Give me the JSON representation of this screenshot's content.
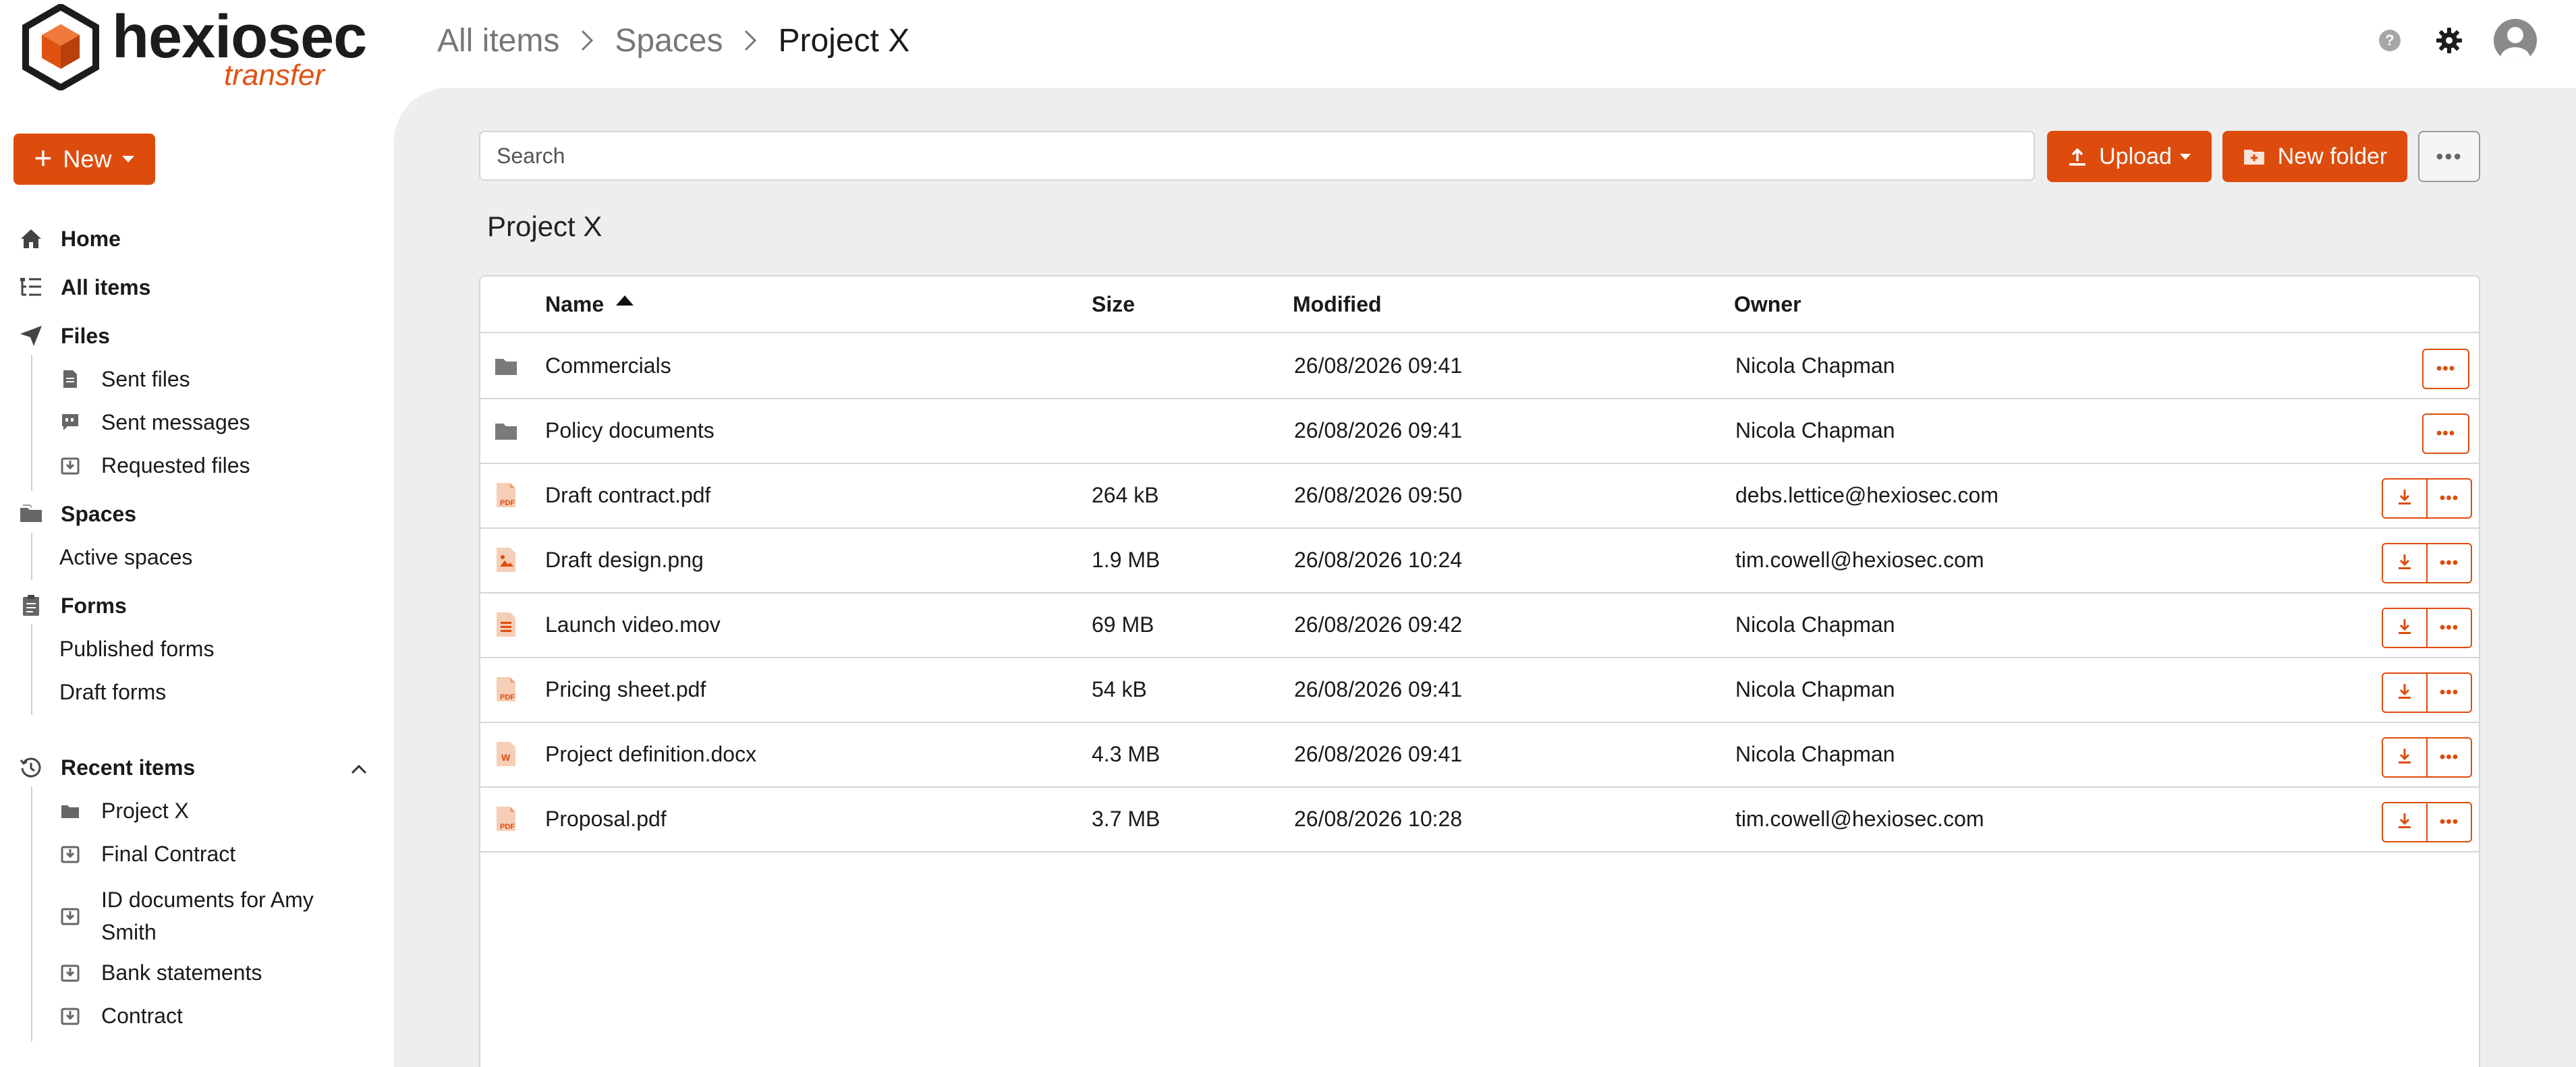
{
  "brand": {
    "name": "hexiosec",
    "product": "transfer",
    "accent": "#dd4c0d"
  },
  "breadcrumb": [
    "All items",
    "Spaces",
    "Project X"
  ],
  "topbar": {
    "help_label": "?",
    "help_icon": "help-icon",
    "settings_icon": "gear-icon",
    "avatar_icon": "user-avatar-icon"
  },
  "sidebar": {
    "new_label": "New",
    "home": "Home",
    "all_items": "All items",
    "files": {
      "label": "Files",
      "items": [
        "Sent files",
        "Sent messages",
        "Requested files"
      ]
    },
    "spaces": {
      "label": "Spaces",
      "items": [
        "Active spaces"
      ]
    },
    "forms": {
      "label": "Forms",
      "items": [
        "Published forms",
        "Draft forms"
      ]
    },
    "recent": {
      "label": "Recent items",
      "items": [
        "Project X",
        "Final Contract",
        "ID documents for Amy Smith",
        "Bank statements",
        "Contract"
      ]
    }
  },
  "toolbar": {
    "search_placeholder": "Search",
    "upload_label": "Upload",
    "new_folder_label": "New folder",
    "more_label": "•••"
  },
  "folder_title": "Project X",
  "table": {
    "columns": [
      "Name",
      "Size",
      "Modified",
      "Owner"
    ],
    "sort": {
      "column": "Name",
      "direction": "ascending"
    },
    "more_label": "•••",
    "rows": [
      {
        "name": "Commercials",
        "size": "",
        "modified": "26/08/2026 09:41",
        "owner": "Nicola Chapman",
        "kind": "folder",
        "icon": "folder-icon"
      },
      {
        "name": "Policy documents",
        "size": "",
        "modified": "26/08/2026 09:41",
        "owner": "Nicola Chapman",
        "kind": "folder",
        "icon": "folder-icon"
      },
      {
        "name": "Draft contract.pdf",
        "size": "264 kB",
        "modified": "26/08/2026 09:50",
        "owner": "debs.lettice@hexiosec.com",
        "kind": "pdf",
        "icon": "pdf-file-icon"
      },
      {
        "name": "Draft design.png",
        "size": "1.9 MB",
        "modified": "26/08/2026 10:24",
        "owner": "tim.cowell@hexiosec.com",
        "kind": "image",
        "icon": "image-file-icon"
      },
      {
        "name": "Launch video.mov",
        "size": "69 MB",
        "modified": "26/08/2026 09:42",
        "owner": "Nicola Chapman",
        "kind": "video",
        "icon": "video-file-icon"
      },
      {
        "name": "Pricing sheet.pdf",
        "size": "54 kB",
        "modified": "26/08/2026 09:41",
        "owner": "Nicola Chapman",
        "kind": "pdf",
        "icon": "pdf-file-icon"
      },
      {
        "name": "Project definition.docx",
        "size": "4.3 MB",
        "modified": "26/08/2026 09:41",
        "owner": "Nicola Chapman",
        "kind": "word",
        "icon": "word-file-icon"
      },
      {
        "name": "Proposal.pdf",
        "size": "3.7 MB",
        "modified": "26/08/2026 10:28",
        "owner": "tim.cowell@hexiosec.com",
        "kind": "pdf",
        "icon": "pdf-file-icon"
      }
    ]
  }
}
